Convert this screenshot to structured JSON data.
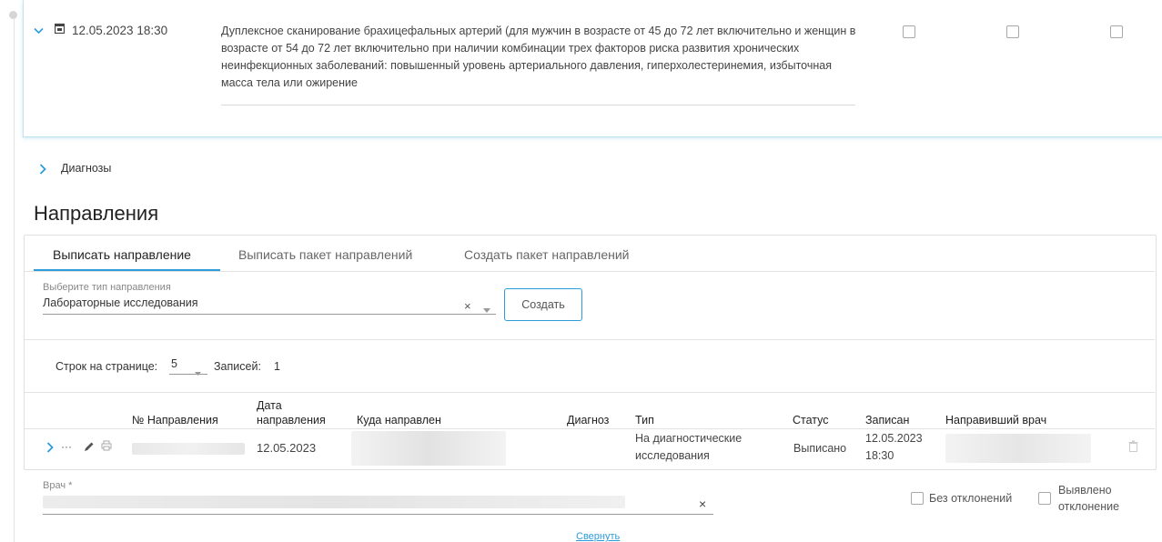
{
  "event": {
    "datetime": "12.05.2023 18:30",
    "description": "Дуплексное сканирование брахицефальных артерий (для мужчин в возрасте от 45 до 72 лет включительно и женщин в возрасте от 54 до 72 лет включительно при наличии комбинации трех факторов риска развития хронических неинфекционных заболеваний: повышенный уровень артериального давления, гиперхолестеринемия, избыточная масса тела или ожирение"
  },
  "diagnoses": {
    "label": "Диагнозы"
  },
  "referrals": {
    "title": "Направления",
    "tabs": [
      "Выписать направление",
      "Выписать пакет направлений",
      "Создать пакет направлений"
    ],
    "type_select": {
      "label": "Выберите тип направления",
      "value": "Лабораторные исследования"
    },
    "create_label": "Создать",
    "pagination": {
      "rows_label": "Строк на странице:",
      "rows_value": "5",
      "records_label": "Записей:",
      "records_value": "1"
    },
    "table": {
      "headers": [
        "№ Направления",
        "Дата направления",
        "Куда направлен",
        "Диагноз",
        "Тип",
        "Статус",
        "Записан",
        "Направивший врач"
      ],
      "rows": [
        {
          "date": "12.05.2023",
          "type": "На диагностические исследования",
          "status": "Выписано",
          "recorded": "12.05.2023 18:30"
        }
      ]
    }
  },
  "doctor": {
    "label": "Врач *"
  },
  "options": {
    "no_deviation": "Без отклонений",
    "deviation_found": "Выявлено отклонение"
  },
  "collapse_label": "Свернуть",
  "icons": [
    "chevron-down-icon",
    "calendar-icon",
    "chevron-right-icon",
    "more-icon",
    "edit-icon",
    "print-icon",
    "trash-icon",
    "clear-icon",
    "dropdown-caret-icon"
  ],
  "colors": {
    "accent": "#2d9cdb"
  }
}
